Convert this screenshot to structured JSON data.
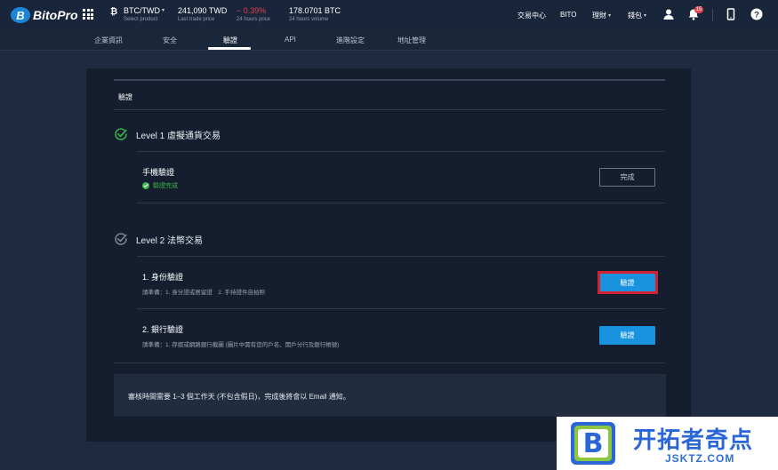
{
  "topbar": {
    "brand": "BitoPro",
    "pair": "BTC/TWD",
    "pair_sub": "Select product",
    "last_price": "241,090 TWD",
    "last_price_sub": "Last trade price",
    "change": "− 0.39%",
    "change_sub": "24 hours price",
    "volume": "178.0701 BTC",
    "volume_sub": "24 hours volume",
    "links": [
      "交易中心",
      "BITO",
      "理財",
      "錢包"
    ],
    "notification_count": "15"
  },
  "tabs": [
    "企業資訊",
    "安全",
    "驗證",
    "API",
    "進階設定",
    "地址管理"
  ],
  "active_tab": "驗證",
  "section_title": "驗證",
  "level1": {
    "title": "Level 1 虛擬通貨交易",
    "item_title": "手機驗證",
    "status": "驗證完成",
    "button": "完成"
  },
  "level2": {
    "title": "Level 2 法幣交易",
    "item1_title": "1. 身份驗證",
    "item1_sub": "請準備：1. 身分證或居留證　2. 手持證件自拍照",
    "item1_button": "驗證",
    "item2_title": "2. 銀行驗證",
    "item2_sub": "請準備：1. 存摺或網路銀行截圖 (圖片中需有您的戶名、開戶分行及銀行帳號)",
    "item2_button": "驗證"
  },
  "notice": "審核時間需要 1–3 個工作天 (不包含假日)，完成後將會以 Email 通知。",
  "watermark": {
    "logo_letter": "B",
    "text_cn": "开拓者奇点",
    "text_en": "JSKTZ.COM"
  },
  "colors": {
    "accent": "#1992e0",
    "success": "#3bb44b",
    "negative": "#e2404f",
    "highlight": "#d5202e"
  }
}
